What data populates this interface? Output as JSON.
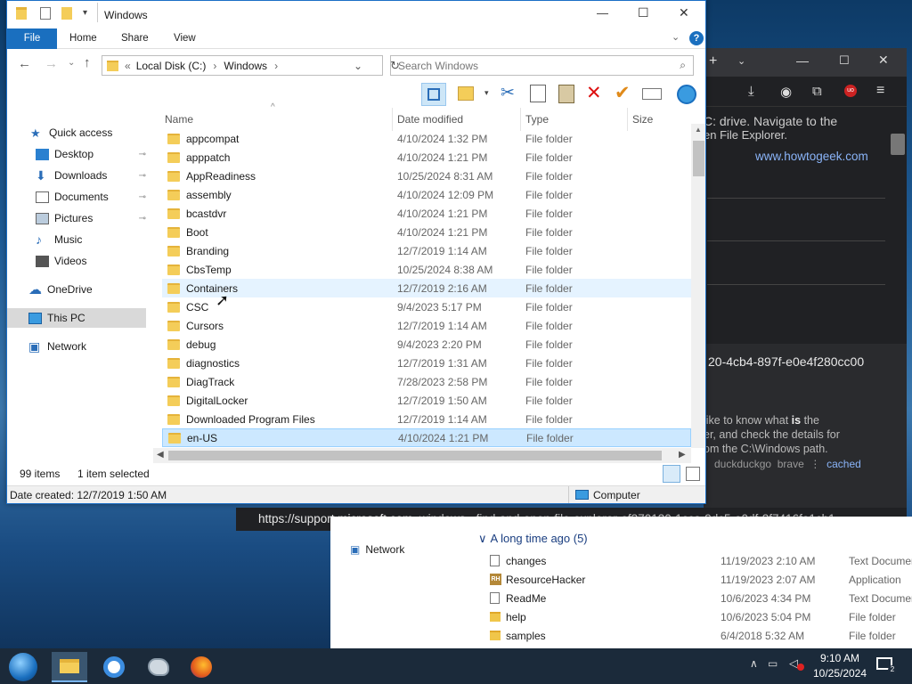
{
  "window": {
    "title": "Windows",
    "controls": {
      "minimize": "—",
      "maximize": "☐",
      "close": "✕"
    }
  },
  "ribbon": {
    "tabs": [
      "File",
      "Home",
      "Share",
      "View"
    ]
  },
  "address": {
    "prefix": "«",
    "segments": [
      "Local Disk (C:)",
      "Windows"
    ]
  },
  "search": {
    "placeholder": "Search Windows"
  },
  "nav": {
    "items": [
      {
        "label": "Quick access",
        "icon": "star-icon"
      },
      {
        "label": "Desktop",
        "icon": "desktop-icon",
        "pinned": true
      },
      {
        "label": "Downloads",
        "icon": "download-icon",
        "pinned": true
      },
      {
        "label": "Documents",
        "icon": "documents-icon",
        "pinned": true
      },
      {
        "label": "Pictures",
        "icon": "pictures-icon",
        "pinned": true
      },
      {
        "label": "Music",
        "icon": "music-icon"
      },
      {
        "label": "Videos",
        "icon": "videos-icon"
      },
      {
        "label": "OneDrive",
        "icon": "cloud-icon"
      },
      {
        "label": "This PC",
        "icon": "computer-icon",
        "selected": true
      },
      {
        "label": "Network",
        "icon": "network-icon"
      }
    ]
  },
  "columns": {
    "name": "Name",
    "date": "Date modified",
    "type": "Type",
    "size": "Size"
  },
  "files": [
    {
      "name": "appcompat",
      "date": "4/10/2024 1:32 PM",
      "type": "File folder"
    },
    {
      "name": "apppatch",
      "date": "4/10/2024 1:21 PM",
      "type": "File folder"
    },
    {
      "name": "AppReadiness",
      "date": "10/25/2024 8:31 AM",
      "type": "File folder"
    },
    {
      "name": "assembly",
      "date": "4/10/2024 12:09 PM",
      "type": "File folder"
    },
    {
      "name": "bcastdvr",
      "date": "4/10/2024 1:21 PM",
      "type": "File folder"
    },
    {
      "name": "Boot",
      "date": "4/10/2024 1:21 PM",
      "type": "File folder"
    },
    {
      "name": "Branding",
      "date": "12/7/2019 1:14 AM",
      "type": "File folder"
    },
    {
      "name": "CbsTemp",
      "date": "10/25/2024 8:38 AM",
      "type": "File folder"
    },
    {
      "name": "Containers",
      "date": "12/7/2019 2:16 AM",
      "type": "File folder",
      "hover": true
    },
    {
      "name": "CSC",
      "date": "9/4/2023 5:17 PM",
      "type": "File folder"
    },
    {
      "name": "Cursors",
      "date": "12/7/2019 1:14 AM",
      "type": "File folder"
    },
    {
      "name": "debug",
      "date": "9/4/2023 2:20 PM",
      "type": "File folder"
    },
    {
      "name": "diagnostics",
      "date": "12/7/2019 1:31 AM",
      "type": "File folder"
    },
    {
      "name": "DiagTrack",
      "date": "7/28/2023 2:58 PM",
      "type": "File folder"
    },
    {
      "name": "DigitalLocker",
      "date": "12/7/2019 1:50 AM",
      "type": "File folder"
    },
    {
      "name": "Downloaded Program Files",
      "date": "12/7/2019 1:14 AM",
      "type": "File folder"
    },
    {
      "name": "en-US",
      "date": "4/10/2024 1:21 PM",
      "type": "File folder",
      "selected": true
    }
  ],
  "status": {
    "count": "99 items",
    "selected": "1 item selected"
  },
  "details": {
    "created": "Date created: 12/7/2019 1:50 AM",
    "location": "Computer"
  },
  "browser": {
    "lines": [
      "C: drive. Navigate to the",
      "en File Explorer."
    ],
    "link": "www.howtogeek.com",
    "guid": "20-4cb4-897f-e0e4f280cc00",
    "snippet": [
      "like to know what ",
      "is",
      " the",
      "er, and check the details for",
      "om the C:\\Windows path."
    ],
    "tags": [
      "duckduckgo",
      "brave",
      "⋮",
      "cached"
    ],
    "url_host": "https://support.microsoft.com",
    "url_path": "windows › find-and-open-file-explorer-ef370130-1cca-9dc5-e0df-2f7416fe1cb1"
  },
  "bg_explorer": {
    "nav_network": "Network",
    "group": "A long time ago (5)",
    "rows": [
      {
        "name": "changes",
        "date": "11/19/2023 2:10 AM",
        "type": "Text Documen",
        "kind": "doc"
      },
      {
        "name": "ResourceHacker",
        "date": "11/19/2023 2:07 AM",
        "type": "Application",
        "kind": "app"
      },
      {
        "name": "ReadMe",
        "date": "10/6/2023 4:34 PM",
        "type": "Text Documen",
        "kind": "doc"
      },
      {
        "name": "help",
        "date": "10/6/2023 5:04 PM",
        "type": "File folder",
        "kind": "folder"
      },
      {
        "name": "samples",
        "date": "6/4/2018 5:32 AM",
        "type": "File folder",
        "kind": "folder"
      }
    ]
  },
  "taskbar": {
    "time": "9:10 AM",
    "date": "10/25/2024",
    "items": [
      "start-orb-icon",
      "file-explorer-icon",
      "chrome-icon",
      "paint-icon",
      "firefox-icon"
    ]
  }
}
